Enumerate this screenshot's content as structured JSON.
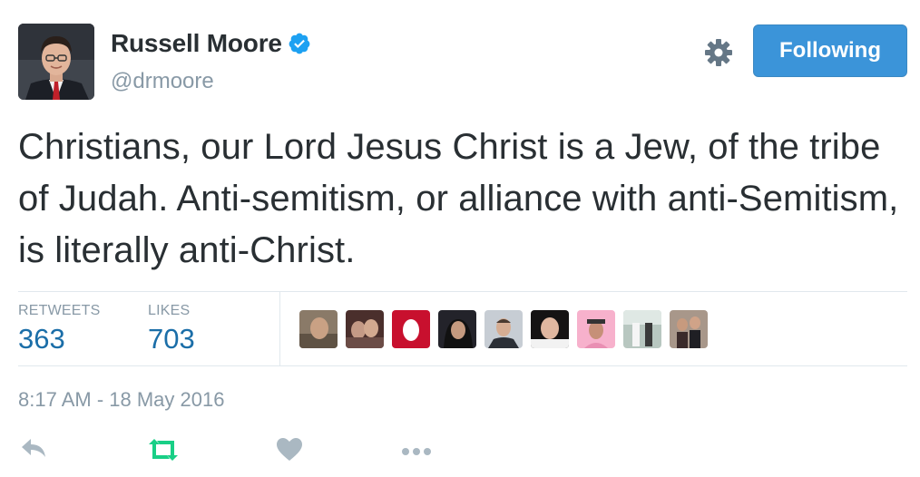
{
  "user": {
    "display_name": "Russell Moore",
    "handle": "@drmoore",
    "verified": true
  },
  "follow_button": {
    "label": "Following"
  },
  "tweet": {
    "text": "Christians, our Lord Jesus Christ is a Jew, of the tribe of Judah. Anti-semitism, or alliance with anti-Semitism, is literally anti-Christ."
  },
  "stats": {
    "retweets_label": "RETWEETS",
    "retweets_count": "363",
    "likes_label": "LIKES",
    "likes_count": "703"
  },
  "timestamp": "8:17 AM - 18 May 2016",
  "likers": [
    {
      "icon": "liker-avatar-1",
      "color": "#7a6a5c"
    },
    {
      "icon": "liker-avatar-2",
      "color": "#5b3f3c"
    },
    {
      "icon": "egg-avatar",
      "color": "#c8102e"
    },
    {
      "icon": "liker-avatar-4",
      "color": "#2c2b2e"
    },
    {
      "icon": "liker-avatar-5",
      "color": "#9aa3ae"
    },
    {
      "icon": "liker-avatar-6",
      "color": "#1e1b1a"
    },
    {
      "icon": "liker-avatar-7",
      "color": "#f6a8c7"
    },
    {
      "icon": "liker-avatar-8",
      "color": "#9cb0a8"
    },
    {
      "icon": "liker-avatar-9",
      "color": "#6d5a4f"
    }
  ],
  "actions": [
    "reply-icon",
    "retweet-icon",
    "like-icon",
    "more-icon"
  ],
  "colors": {
    "accent": "#3b94d9",
    "count": "#1b6ea8",
    "muted": "#8899a6",
    "retweet_green": "#19cf86",
    "icon_gray": "#aab8c2"
  }
}
